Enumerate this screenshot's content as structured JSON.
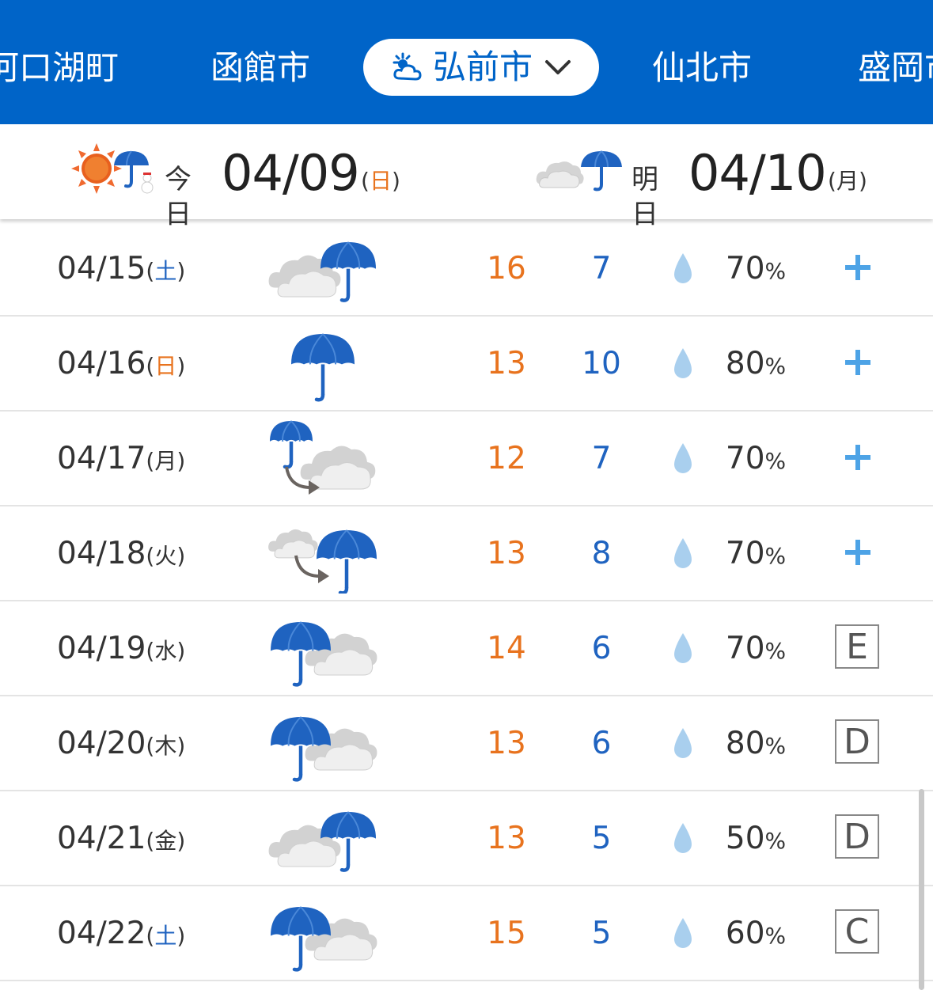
{
  "cities": {
    "items": [
      "河口湖町",
      "函館市",
      "弘前市",
      "仙北市",
      "盛岡市"
    ],
    "active": "弘前市",
    "active_icon": "sun-cloud-icon"
  },
  "today": {
    "label": "今日",
    "date": "04/09",
    "weekday": "日",
    "icon": "sunny-then-rain-snow-icon"
  },
  "tomorrow": {
    "label": "明日",
    "date": "04/10",
    "weekday": "月",
    "icon": "cloudy-then-rain-icon"
  },
  "colors": {
    "accent": "#0064c8",
    "high": "#e8731e",
    "low": "#1f63c0",
    "drop": "#a9cfee",
    "plus": "#4da3e6",
    "saturday": "#1f63c0",
    "sunday": "#e8731e"
  },
  "forecast": [
    {
      "date": "04/15",
      "weekday": "土",
      "weather": "cloudy-with-rain",
      "weather_icon": "cloud-umbrella-icon",
      "high": "16",
      "low": "7",
      "pop": "70",
      "pop_unit": "%",
      "reliability": "+"
    },
    {
      "date": "04/16",
      "weekday": "日",
      "weather": "rain",
      "weather_icon": "umbrella-icon",
      "high": "13",
      "low": "10",
      "pop": "80",
      "pop_unit": "%",
      "reliability": "+"
    },
    {
      "date": "04/17",
      "weekday": "月",
      "weather": "rain-then-cloudy",
      "weather_icon": "rain-then-cloud-icon",
      "high": "12",
      "low": "7",
      "pop": "70",
      "pop_unit": "%",
      "reliability": "+"
    },
    {
      "date": "04/18",
      "weekday": "火",
      "weather": "cloudy-then-rain",
      "weather_icon": "cloud-then-rain-icon",
      "high": "13",
      "low": "8",
      "pop": "70",
      "pop_unit": "%",
      "reliability": "+"
    },
    {
      "date": "04/19",
      "weekday": "水",
      "weather": "rain-with-clouds",
      "weather_icon": "umbrella-cloud-icon",
      "high": "14",
      "low": "6",
      "pop": "70",
      "pop_unit": "%",
      "reliability": "E"
    },
    {
      "date": "04/20",
      "weekday": "木",
      "weather": "rain-with-clouds",
      "weather_icon": "umbrella-cloud-icon",
      "high": "13",
      "low": "6",
      "pop": "80",
      "pop_unit": "%",
      "reliability": "D"
    },
    {
      "date": "04/21",
      "weekday": "金",
      "weather": "cloudy-with-rain",
      "weather_icon": "cloud-umbrella-icon",
      "high": "13",
      "low": "5",
      "pop": "50",
      "pop_unit": "%",
      "reliability": "D"
    },
    {
      "date": "04/22",
      "weekday": "土",
      "weather": "rain-with-clouds",
      "weather_icon": "umbrella-cloud-icon",
      "high": "15",
      "low": "5",
      "pop": "60",
      "pop_unit": "%",
      "reliability": "C"
    }
  ]
}
